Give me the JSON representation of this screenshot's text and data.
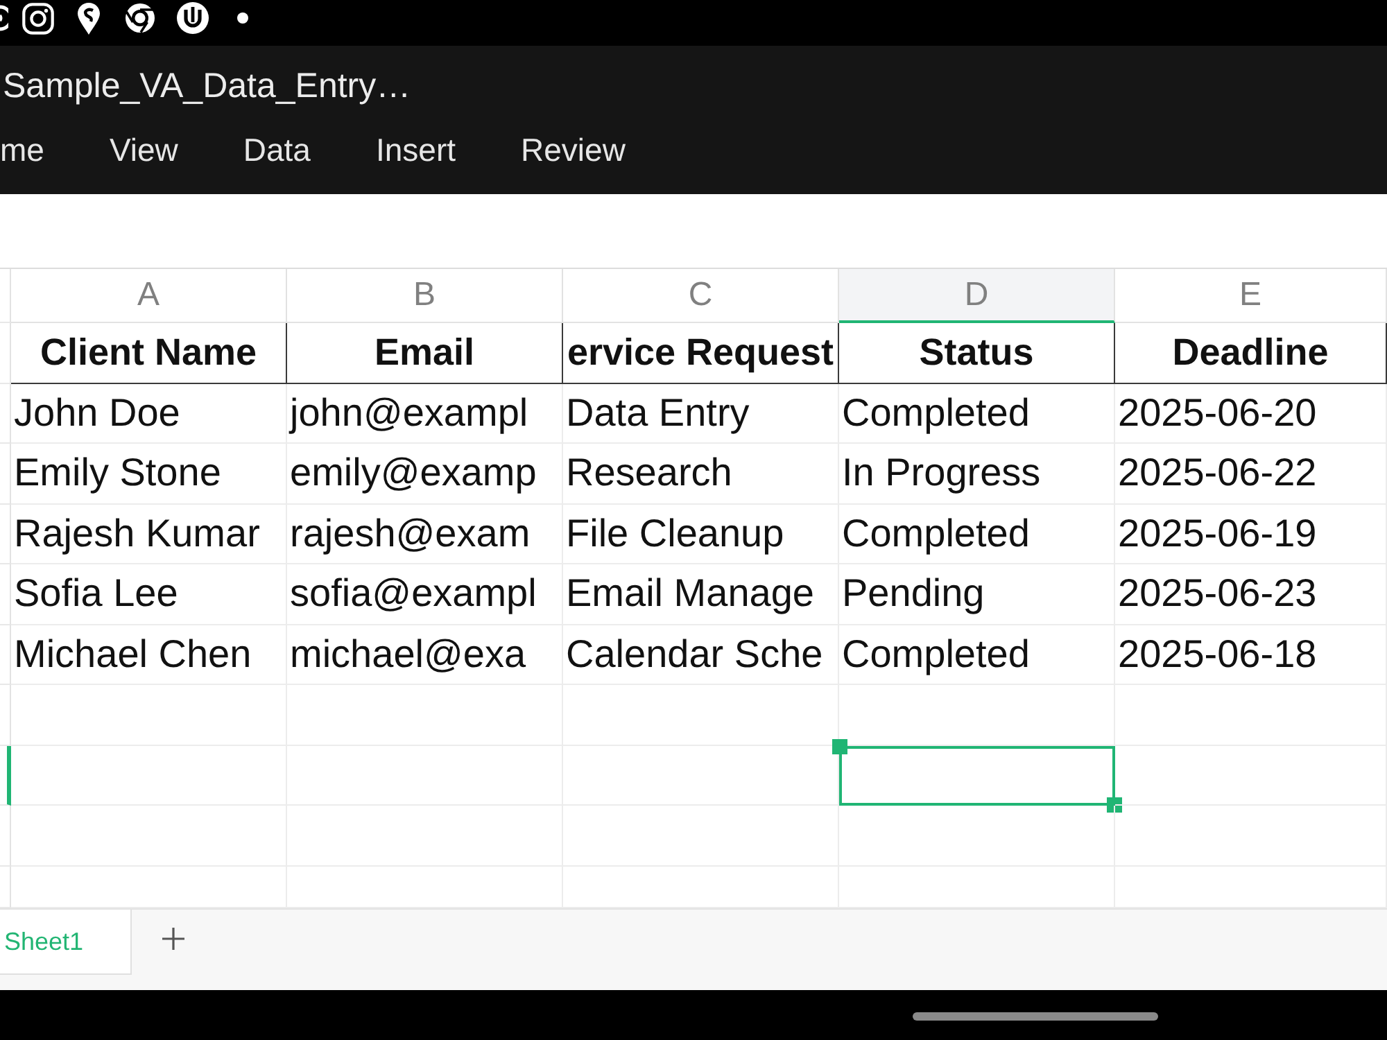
{
  "window": {
    "title": "Sample_VA_Data_Entry…"
  },
  "menu": [
    "me",
    "View",
    "Data",
    "Insert",
    "Review"
  ],
  "grid": {
    "columns": [
      {
        "letter": "A",
        "heading": "Client Name",
        "selected": false
      },
      {
        "letter": "B",
        "heading": "Email",
        "selected": false
      },
      {
        "letter": "C",
        "heading": "ervice Request",
        "selected": false
      },
      {
        "letter": "D",
        "heading": "Status",
        "selected": true
      },
      {
        "letter": "E",
        "heading": "Deadline",
        "selected": false
      }
    ],
    "rows": [
      {
        "cells": [
          "John Doe",
          "john@exampl",
          "Data Entry",
          "Completed",
          "2025-06-20"
        ],
        "selected": false
      },
      {
        "cells": [
          "Emily Stone",
          "emily@examp",
          "Research",
          "In Progress",
          "2025-06-22"
        ],
        "selected": false
      },
      {
        "cells": [
          "Rajesh Kumar",
          "rajesh@exam",
          "File Cleanup",
          "Completed",
          "2025-06-19"
        ],
        "selected": false
      },
      {
        "cells": [
          "Sofia Lee",
          "sofia@exampl",
          "Email Manage",
          "Pending",
          "2025-06-23"
        ],
        "selected": false
      },
      {
        "cells": [
          "Michael Chen",
          "michael@exa",
          "Calendar Sche",
          "Completed",
          "2025-06-18"
        ],
        "selected": false
      },
      {
        "selected": false
      },
      {
        "selected": true
      },
      {
        "selected": false
      },
      {
        "selected": false
      }
    ]
  },
  "sheet_tabs": [
    {
      "label": "Sheet1",
      "selected": true
    }
  ]
}
